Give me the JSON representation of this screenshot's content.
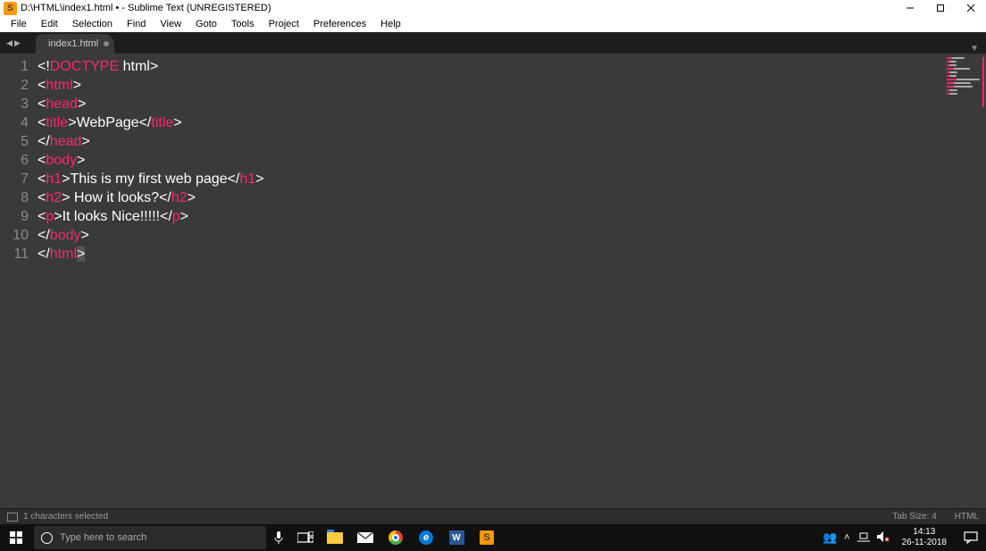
{
  "window": {
    "title": "D:\\HTML\\index1.html • - Sublime Text (UNREGISTERED)"
  },
  "menu": [
    "File",
    "Edit",
    "Selection",
    "Find",
    "View",
    "Goto",
    "Tools",
    "Project",
    "Preferences",
    "Help"
  ],
  "tab": {
    "name": "index1.html",
    "dirty": true
  },
  "code_lines": [
    [
      {
        "c": "p",
        "t": "<!"
      },
      {
        "c": "kw",
        "t": "DOCTYPE"
      },
      {
        "c": "p",
        "t": " "
      },
      {
        "c": "tx",
        "t": "html"
      },
      {
        "c": "p",
        "t": ">"
      }
    ],
    [
      {
        "c": "p",
        "t": "<"
      },
      {
        "c": "kw",
        "t": "html"
      },
      {
        "c": "p",
        "t": ">"
      }
    ],
    [
      {
        "c": "p",
        "t": "<"
      },
      {
        "c": "kw",
        "t": "head"
      },
      {
        "c": "p",
        "t": ">"
      }
    ],
    [
      {
        "c": "p",
        "t": "<"
      },
      {
        "c": "kw",
        "t": "title"
      },
      {
        "c": "p",
        "t": ">"
      },
      {
        "c": "tx",
        "t": "WebPage"
      },
      {
        "c": "p",
        "t": "</"
      },
      {
        "c": "kw",
        "t": "title"
      },
      {
        "c": "p",
        "t": ">"
      }
    ],
    [
      {
        "c": "p",
        "t": "</"
      },
      {
        "c": "kw",
        "t": "head"
      },
      {
        "c": "p",
        "t": ">"
      }
    ],
    [
      {
        "c": "p",
        "t": "<"
      },
      {
        "c": "kw",
        "t": "body"
      },
      {
        "c": "p",
        "t": ">"
      }
    ],
    [
      {
        "c": "p",
        "t": "<"
      },
      {
        "c": "kw",
        "t": "h1"
      },
      {
        "c": "p",
        "t": ">"
      },
      {
        "c": "tx",
        "t": "This is my first web page"
      },
      {
        "c": "p",
        "t": "</"
      },
      {
        "c": "kw",
        "t": "h1"
      },
      {
        "c": "p",
        "t": ">"
      }
    ],
    [
      {
        "c": "p",
        "t": "<"
      },
      {
        "c": "kw",
        "t": "h2"
      },
      {
        "c": "p",
        "t": ">"
      },
      {
        "c": "tx",
        "t": " How it looks?"
      },
      {
        "c": "p",
        "t": "</"
      },
      {
        "c": "kw",
        "t": "h2"
      },
      {
        "c": "p",
        "t": ">"
      }
    ],
    [
      {
        "c": "p",
        "t": "<"
      },
      {
        "c": "kw",
        "t": "p"
      },
      {
        "c": "p",
        "t": ">"
      },
      {
        "c": "tx",
        "t": "It looks Nice!!!!!"
      },
      {
        "c": "p",
        "t": "</"
      },
      {
        "c": "kw",
        "t": "p"
      },
      {
        "c": "p",
        "t": ">"
      }
    ],
    [
      {
        "c": "p",
        "t": "</"
      },
      {
        "c": "kw",
        "t": "body"
      },
      {
        "c": "p",
        "t": ">"
      }
    ],
    [
      {
        "c": "p",
        "t": "</"
      },
      {
        "c": "kw",
        "t": "html"
      },
      {
        "c": "sel",
        "t": ">"
      }
    ]
  ],
  "statusbar": {
    "selection": "1 characters selected",
    "tab_size": "Tab Size: 4",
    "syntax": "HTML"
  },
  "taskbar": {
    "search_placeholder": "Type here to search",
    "time": "14:13",
    "date": "26-11-2018"
  }
}
